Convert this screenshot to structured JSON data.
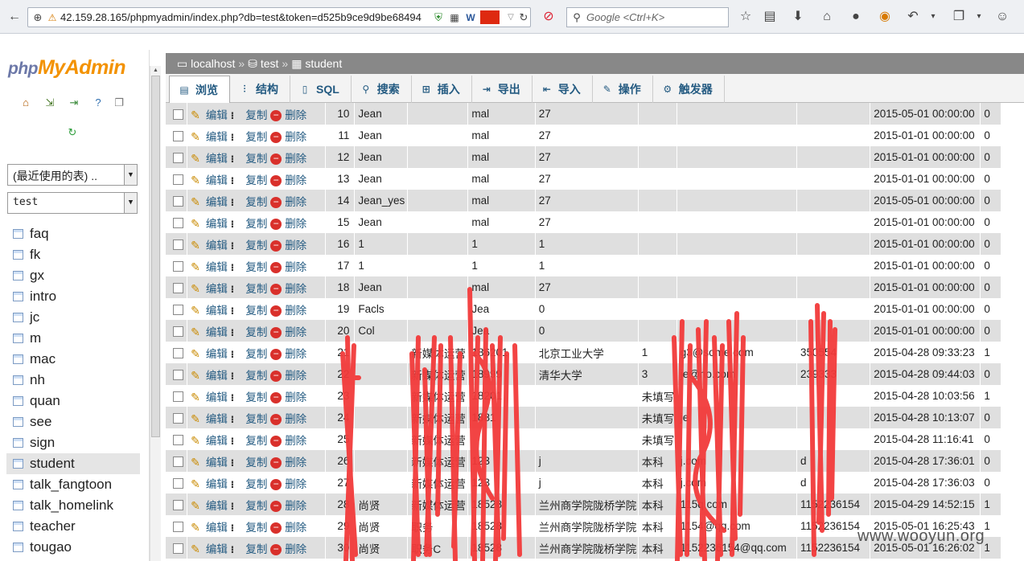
{
  "browser": {
    "url": "42.159.28.165/phpmyadmin/index.php?db=test&token=d525b9ce9d9be68494",
    "search_placeholder": "Google <Ctrl+K>"
  },
  "sidebar": {
    "logo_php": "php",
    "logo_myadmin": "MyAdmin",
    "recent_tables": "(最近使用的表) ..",
    "db_select": "test",
    "tables": [
      "faq",
      "fk",
      "gx",
      "intro",
      "jc",
      "m",
      "mac",
      "nh",
      "quan",
      "see",
      "sign",
      "student",
      "talk_fangtoon",
      "talk_homelink",
      "teacher",
      "tougao"
    ],
    "active_table": "student"
  },
  "breadcrumb": {
    "server": "localhost",
    "db": "test",
    "table": "student",
    "sep": "»"
  },
  "tabs": [
    {
      "label": "浏览",
      "icon": "browse-icon",
      "active": true
    },
    {
      "label": "结构",
      "icon": "structure-icon"
    },
    {
      "label": "SQL",
      "icon": "sql-icon"
    },
    {
      "label": "搜索",
      "icon": "search-icon"
    },
    {
      "label": "插入",
      "icon": "insert-icon"
    },
    {
      "label": "导出",
      "icon": "export-icon"
    },
    {
      "label": "导入",
      "icon": "import-icon"
    },
    {
      "label": "操作",
      "icon": "wrench-icon"
    },
    {
      "label": "触发器",
      "icon": "trigger-icon"
    }
  ],
  "actions": {
    "edit": "编辑",
    "copy": "复制",
    "delete": "删除"
  },
  "rows": [
    [
      "10",
      "Jean",
      "",
      "mal",
      "27",
      "",
      "",
      "",
      "2015-05-01 00:00:00",
      "0"
    ],
    [
      "11",
      "Jean",
      "",
      "mal",
      "27",
      "",
      "",
      "",
      "2015-01-01 00:00:00",
      "0"
    ],
    [
      "12",
      "Jean",
      "",
      "mal",
      "27",
      "",
      "",
      "",
      "2015-01-01 00:00:00",
      "0"
    ],
    [
      "13",
      "Jean",
      "",
      "mal",
      "27",
      "",
      "",
      "",
      "2015-01-01 00:00:00",
      "0"
    ],
    [
      "14",
      "Jean_yes",
      "",
      "mal",
      "27",
      "",
      "",
      "",
      "2015-05-01 00:00:00",
      "0"
    ],
    [
      "15",
      "Jean",
      "",
      "mal",
      "27",
      "",
      "",
      "",
      "2015-01-01 00:00:00",
      "0"
    ],
    [
      "16",
      "1",
      "",
      "1",
      "1",
      "",
      "",
      "",
      "2015-01-01 00:00:00",
      "0"
    ],
    [
      "17",
      "1",
      "",
      "1",
      "1",
      "",
      "",
      "",
      "2015-01-01 00:00:00",
      "0"
    ],
    [
      "18",
      "Jean",
      "",
      "mal",
      "27",
      "",
      "",
      "",
      "2015-01-01 00:00:00",
      "0"
    ],
    [
      "19",
      "Facls",
      "",
      "Jea",
      "0",
      "",
      "",
      "",
      "2015-01-01 00:00:00",
      "0"
    ],
    [
      "20",
      "Col",
      "",
      "Jea",
      "0",
      "",
      "",
      "",
      "2015-01-01 00:00:00",
      "0"
    ],
    [
      "21",
      "",
      "新媒体运营",
      "186201",
      "北京工业大学",
      "1",
      "g3@some.com",
      "350554",
      "2015-04-28 09:33:23",
      "1"
    ],
    [
      "22",
      "",
      "新媒体运营",
      "18999",
      "清华大学",
      "3",
      "je@no.com",
      "239333",
      "2015-04-28 09:44:03",
      "0"
    ],
    [
      "23",
      "",
      "新媒体运营",
      "18201",
      "",
      "未填写",
      "",
      "",
      "2015-04-28 10:03:56",
      "1"
    ],
    [
      "24",
      "",
      "新媒体运营",
      "1881",
      "",
      "未填写",
      "je",
      "",
      "2015-04-28 10:13:07",
      "0"
    ],
    [
      "25",
      "",
      "新媒体运营",
      "",
      "",
      "未填写",
      "",
      "",
      "2015-04-28 11:16:41",
      "0"
    ],
    [
      "26",
      "",
      "新媒体运营",
      "123",
      "j",
      "本科",
      "j.com",
      "d",
      "2015-04-28 17:36:01",
      "0"
    ],
    [
      "27",
      "",
      "新媒体运营",
      "123",
      "j",
      "本科",
      "j.com",
      "d",
      "2015-04-28 17:36:03",
      "0"
    ],
    [
      "28",
      "尚贤",
      "新媒体运营",
      "18528",
      "兰州商学院陇桥学院",
      "本科",
      "115q.com",
      "1152236154",
      "2015-04-29 14:52:15",
      "1"
    ],
    [
      "29",
      "尚贤",
      "职务",
      "18528",
      "兰州商学院陇桥学院",
      "本科",
      "1154@qq.com",
      "1152236154",
      "2015-05-01 16:25:43",
      "1"
    ],
    [
      "30",
      "尚贤",
      "职务C",
      "18528",
      "兰州商学院陇桥学院",
      "本科",
      "1152236154@qq.com",
      "1152236154",
      "2015-05-01 16:26:02",
      "1"
    ]
  ],
  "watermark": "www.wooyun.org"
}
